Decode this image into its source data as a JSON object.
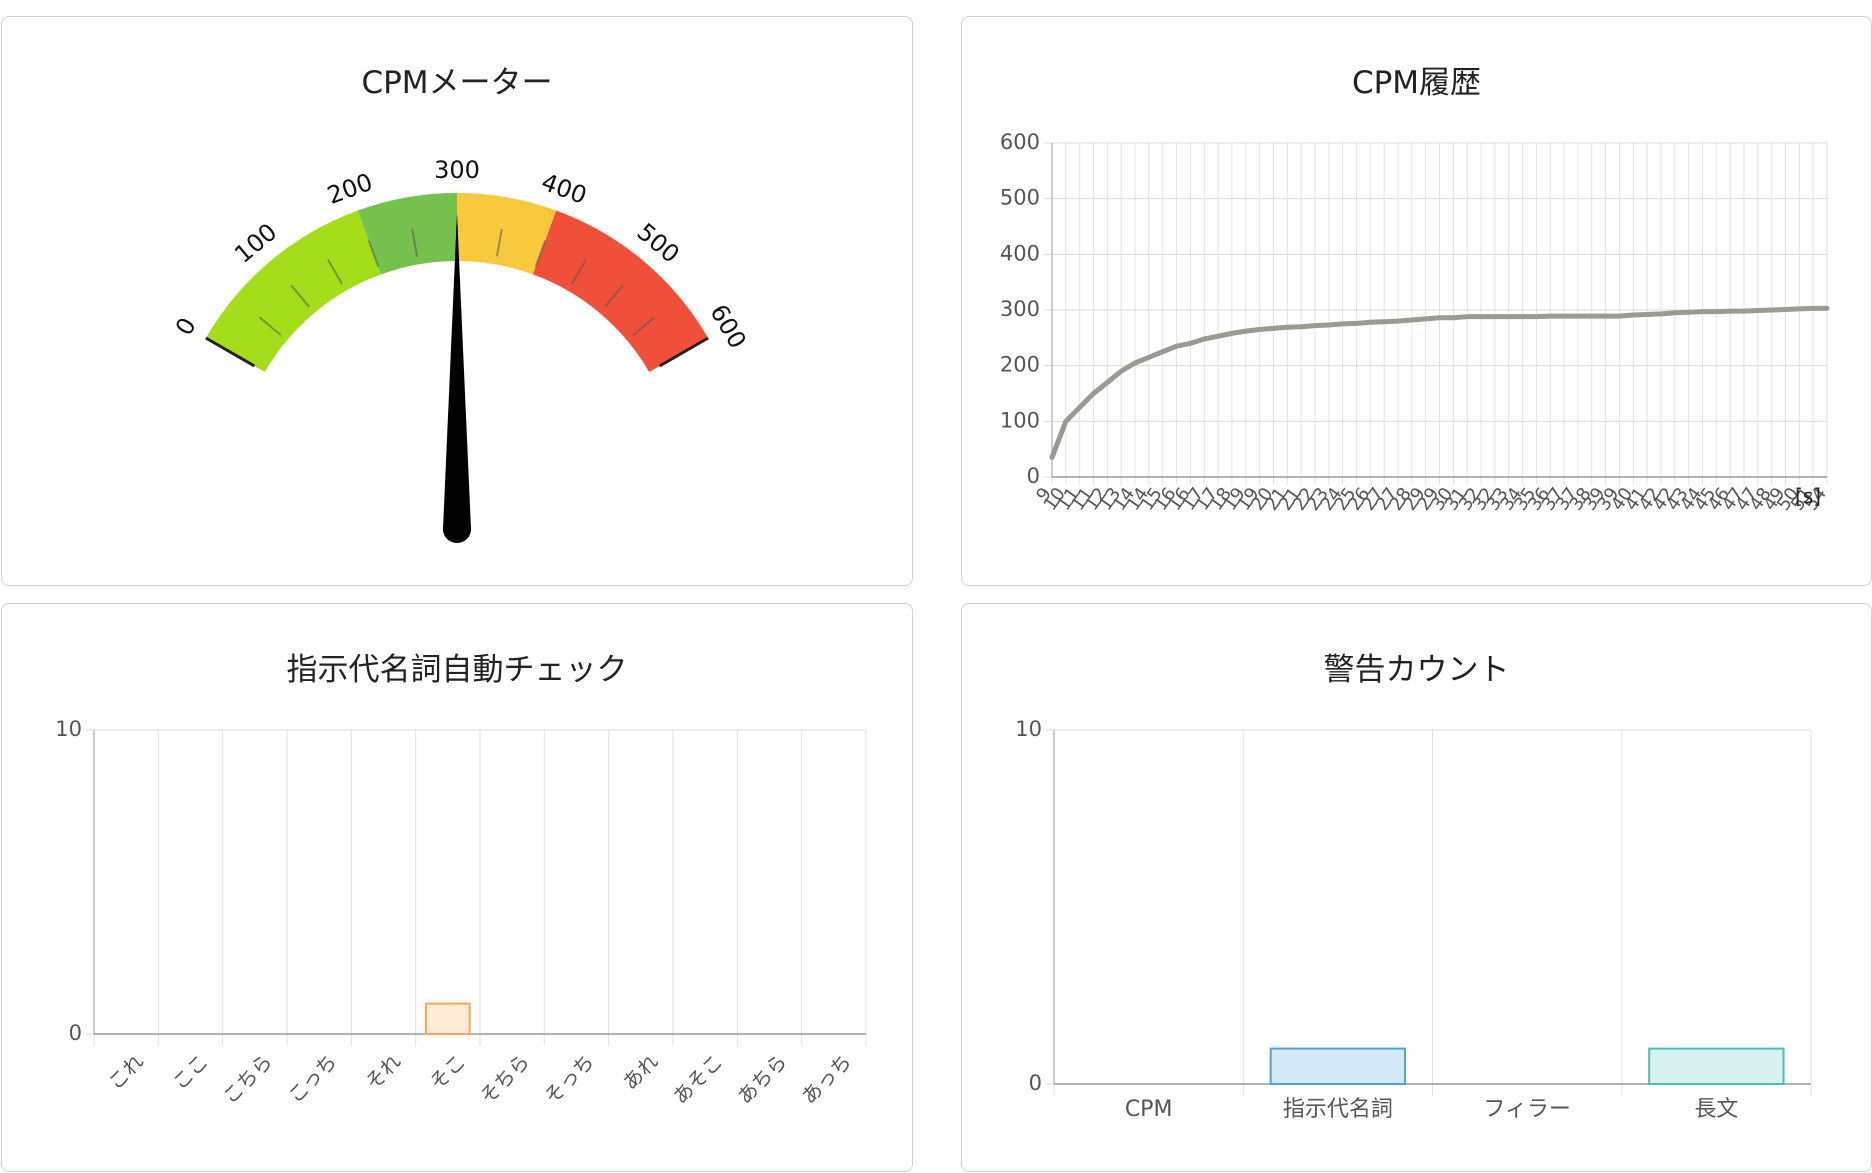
{
  "panels": {
    "meter": {
      "title": "CPMメーター"
    },
    "history": {
      "title": "CPM履歴"
    },
    "demonstratives": {
      "title": "指示代名詞自動チェック"
    },
    "warnings": {
      "title": "警告カウント"
    }
  },
  "chart_data": [
    {
      "type": "gauge",
      "id": "cpm-meter",
      "title": "CPMメーター",
      "min": 0,
      "max": 600,
      "value": 300,
      "tick_labels": [
        "0",
        "100",
        "200",
        "300",
        "400",
        "500",
        "600"
      ],
      "bands": [
        {
          "from": 0,
          "to": 200,
          "color": "#a4dd1a"
        },
        {
          "from": 200,
          "to": 300,
          "color": "#76c04e"
        },
        {
          "from": 300,
          "to": 400,
          "color": "#f8c93c"
        },
        {
          "from": 400,
          "to": 600,
          "color": "#f0503a"
        }
      ]
    },
    {
      "type": "line",
      "id": "cpm-history",
      "title": "CPM履歴",
      "xlabel": "[s]",
      "ylabel": "",
      "ylim": [
        0,
        600
      ],
      "yticks": [
        "0",
        "100",
        "200",
        "300",
        "400",
        "500",
        "600"
      ],
      "x": [
        "9",
        "10",
        "11",
        "11",
        "12",
        "13",
        "14",
        "14",
        "15",
        "16",
        "16",
        "17",
        "17",
        "18",
        "19",
        "19",
        "20",
        "21",
        "21",
        "22",
        "23",
        "24",
        "25",
        "26",
        "27",
        "27",
        "28",
        "29",
        "29",
        "30",
        "31",
        "32",
        "32",
        "33",
        "34",
        "35",
        "36",
        "37",
        "37",
        "38",
        "39",
        "39",
        "40",
        "41",
        "42",
        "42",
        "43",
        "44",
        "45",
        "46",
        "47",
        "47",
        "48",
        "49",
        "50",
        "51",
        "54"
      ],
      "color": "#9a9a90",
      "series": [
        {
          "values": [
            35,
            100,
            125,
            150,
            170,
            190,
            205,
            215,
            225,
            235,
            240,
            248,
            253,
            258,
            262,
            265,
            267,
            269,
            270,
            272,
            273,
            275,
            276,
            278,
            279,
            280,
            282,
            284,
            286,
            286,
            288,
            288,
            288,
            288,
            288,
            288,
            289,
            289,
            289,
            289,
            289,
            289,
            291,
            292,
            293,
            295,
            296,
            297,
            297,
            298,
            298,
            299,
            300,
            301,
            302,
            303,
            303
          ]
        }
      ]
    },
    {
      "type": "bar",
      "id": "demonstrative-check",
      "title": "指示代名詞自動チェック",
      "categories": [
        "これ",
        "ここ",
        "こちら",
        "こっち",
        "それ",
        "そこ",
        "そちら",
        "そっち",
        "あれ",
        "あそこ",
        "あちら",
        "あっち"
      ],
      "ylim": [
        0,
        10
      ],
      "yticks": [
        "0",
        "10"
      ],
      "series": [
        {
          "values": [
            0,
            0,
            0,
            0,
            0,
            1,
            0,
            0,
            0,
            0,
            0,
            0
          ],
          "fill": "#ffecd8",
          "stroke": "#f5a85a"
        }
      ]
    },
    {
      "type": "bar",
      "id": "warning-count",
      "title": "警告カウント",
      "categories": [
        "CPM",
        "指示代名詞",
        "フィラー",
        "長文"
      ],
      "ylim": [
        0,
        10
      ],
      "yticks": [
        "0",
        "10"
      ],
      "series": [
        {
          "values": [
            0,
            1,
            0,
            1
          ],
          "fills": [
            "#fde3e8",
            "#d6e9f8",
            "#fff1cf",
            "#d6f1ef"
          ],
          "strokes": [
            "#f28aa0",
            "#4ba3e0",
            "#f5c242",
            "#4cbdb4"
          ]
        }
      ]
    }
  ]
}
